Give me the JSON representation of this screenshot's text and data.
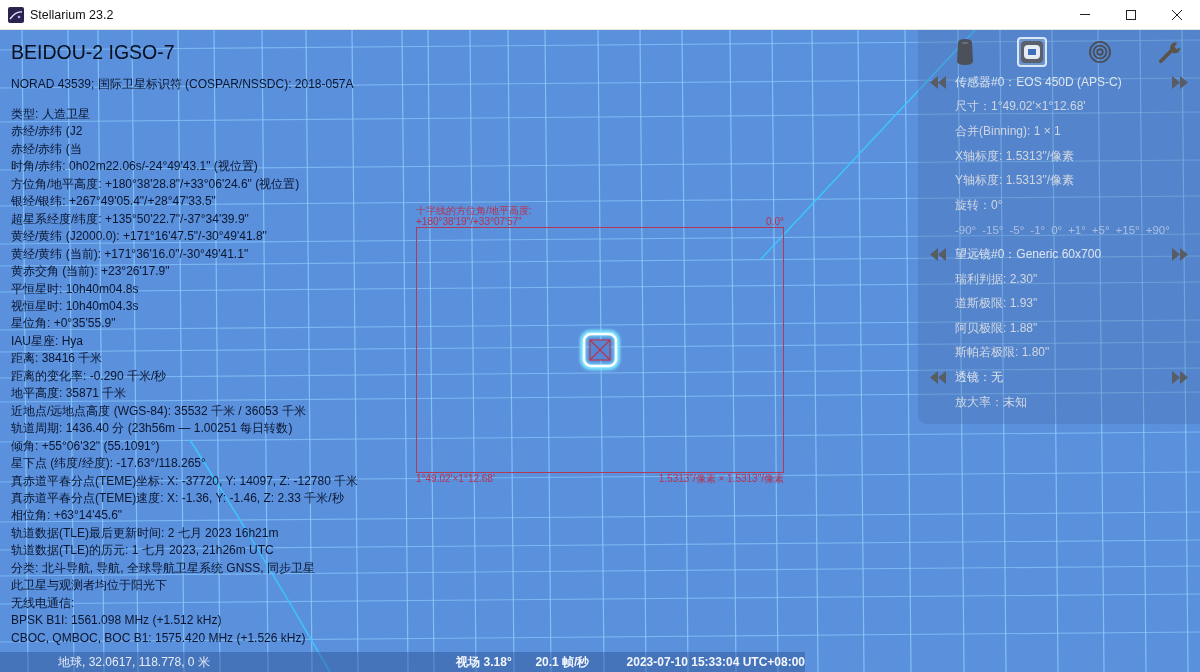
{
  "window": {
    "title": "Stellarium 23.2"
  },
  "object_info": {
    "name": "BEIDOU-2 IGSO-7",
    "subtitle": "NORAD 43539; 国际卫星标识符 (COSPAR/NSSDC): 2018-057A",
    "lines": [
      "类型: 人造卫星",
      "赤经/赤纬 (J2",
      "赤经/赤纬 (当",
      "时角/赤纬: 0h02m22.06s/-24°49'43.1\" (视位置)",
      "方位角/地平高度: +180°38'28.8\"/+33°06'24.6\" (视位置)",
      "银经/银纬: +267°49'05.4\"/+28°47'33.5\"",
      "超星系经度/纬度: +135°50'22.7\"/-37°34'39.9\"",
      "黄经/黄纬 (J2000.0): +171°16'47.5\"/-30°49'41.8\"",
      "黄经/黄纬 (当前): +171°36'16.0\"/-30°49'41.1\"",
      "黄赤交角 (当前): +23°26'17.9\"",
      "平恒星时: 10h40m04.8s",
      "视恒星时: 10h40m04.3s",
      "星位角: +0°35'55.9\"",
      "IAU星座: Hya",
      "距离: 38416 千米",
      "距离的变化率: -0.290 千米/秒",
      "地平高度: 35871 千米",
      "近地点/远地点高度 (WGS-84): 35532 千米 / 36053 千米",
      "轨道周期: 1436.40 分 (23h56m — 1.00251 每日转数)",
      "倾角: +55°06'32\" (55.1091°)",
      "星下点 (纬度/经度): -17.63°/118.265°",
      "真赤道平春分点(TEME)坐标: X: -37720, Y: 14097, Z: -12780 千米",
      "真赤道平春分点(TEME)速度: X: -1.36, Y: -1.46, Z: 2.33 千米/秒",
      "相位角: +63°14'45.6\"",
      "轨道数据(TLE)最后更新时间: 2 七月 2023 16h21m",
      "轨道数据(TLE)的历元: 1 七月 2023, 21h26m UTC",
      "分类: 北斗导航, 导航, 全球导航卫星系统 GNSS, 同步卫星",
      "此卫星与观测者均位于阳光下",
      "无线电通信:",
      "BPSK B1I: 1561.098 MHz (+1.512 kHz)",
      "CBOC, QMBOC, BOC B1: 1575.420 MHz (+1.526 kHz)"
    ]
  },
  "oculars_panel": {
    "tools": [
      {
        "kind": "ocular",
        "selected": false
      },
      {
        "kind": "sensor",
        "selected": true
      },
      {
        "kind": "telrad",
        "selected": false
      },
      {
        "kind": "settings",
        "selected": false
      }
    ],
    "rows": [
      {
        "kind": "selector",
        "text": "传感器#0：EOS 450D (APS-C)"
      },
      {
        "kind": "info",
        "text": "尺寸：1°49.02'×1°12.68'"
      },
      {
        "kind": "info",
        "text": "合并(Binning): 1 × 1"
      },
      {
        "kind": "info",
        "text": "X轴标度: 1.5313\"/像素"
      },
      {
        "kind": "info",
        "text": "Y轴标度: 1.5313\"/像素"
      },
      {
        "kind": "info",
        "text": "旋转：0°"
      },
      {
        "kind": "rotation",
        "buttons": [
          "-90°",
          "-15°",
          "-5°",
          "-1°",
          "0°",
          "+1°",
          "+5°",
          "+15°",
          "+90°"
        ]
      },
      {
        "kind": "selector",
        "text": "望远镜#0：Generic 60x700"
      },
      {
        "kind": "info",
        "text": "瑞利判据: 2.30\""
      },
      {
        "kind": "info",
        "text": "道斯极限: 1.93\""
      },
      {
        "kind": "info",
        "text": "阿贝极限: 1.88\""
      },
      {
        "kind": "info",
        "text": "斯帕若极限: 1.80\""
      },
      {
        "kind": "selector",
        "text": "透镜：无"
      },
      {
        "kind": "info",
        "text": "放大率：未知"
      }
    ]
  },
  "ccd_frame": {
    "crosshair_label": "十字线的方位角/地平高度:",
    "crosshair_value": "+180°38'19\"/+33°07'57\"",
    "rotation": "0.0°",
    "size": "1°49.02'×1°12.68'",
    "scale": "1.5313\"/像素 × 1.5313\"/像素"
  },
  "status_bar": {
    "location": "地球, 32.0617, 118.778, 0 米",
    "fov": "视场 3.18°",
    "fps": "20.1 帧/秒",
    "datetime": "2023-07-10 15:33:04 UTC+08:00"
  }
}
